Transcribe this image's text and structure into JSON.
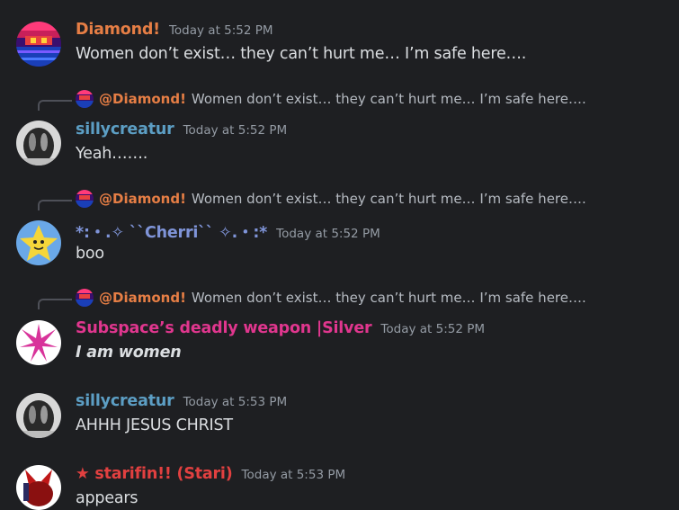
{
  "colors": {
    "background": "#1e1f22",
    "text": "#dbdee1",
    "timestamp": "#949ba4",
    "diamond": "#e67e45",
    "sillycreatur": "#5c9ec4",
    "cherri": "#7f94d8",
    "silver": "#e0368e",
    "stari": "#e24040"
  },
  "messages": [
    {
      "author": "Diamond!",
      "timestamp": "Today at 5:52 PM",
      "content": "Women don’t exist… they can’t hurt me… I’m safe here…."
    },
    {
      "reply": {
        "author": "@Diamond!",
        "text": "Women don’t exist… they can’t hurt me… I’m safe here…."
      },
      "author": "sillycreatur",
      "timestamp": "Today at 5:52 PM",
      "content": "Yeah……."
    },
    {
      "reply": {
        "author": "@Diamond!",
        "text": "Women don’t exist… they can’t hurt me… I’m safe here…."
      },
      "author": "*:・.✧ ``Cherri`` ✧.・:*",
      "timestamp": "Today at 5:52 PM",
      "content": "boo"
    },
    {
      "reply": {
        "author": "@Diamond!",
        "text": "Women don’t exist… they can’t hurt me… I’m safe here…."
      },
      "author": "Subspace’s deadly weapon |Silver",
      "timestamp": "Today at 5:52 PM",
      "content": "I am women"
    },
    {
      "author": "sillycreatur",
      "timestamp": "Today at 5:53 PM",
      "content": "AHHH JESUS CHRIST"
    },
    {
      "author": "★ starifin!! (Stari)",
      "timestamp": "Today at 5:53 PM",
      "content": "appears"
    }
  ]
}
